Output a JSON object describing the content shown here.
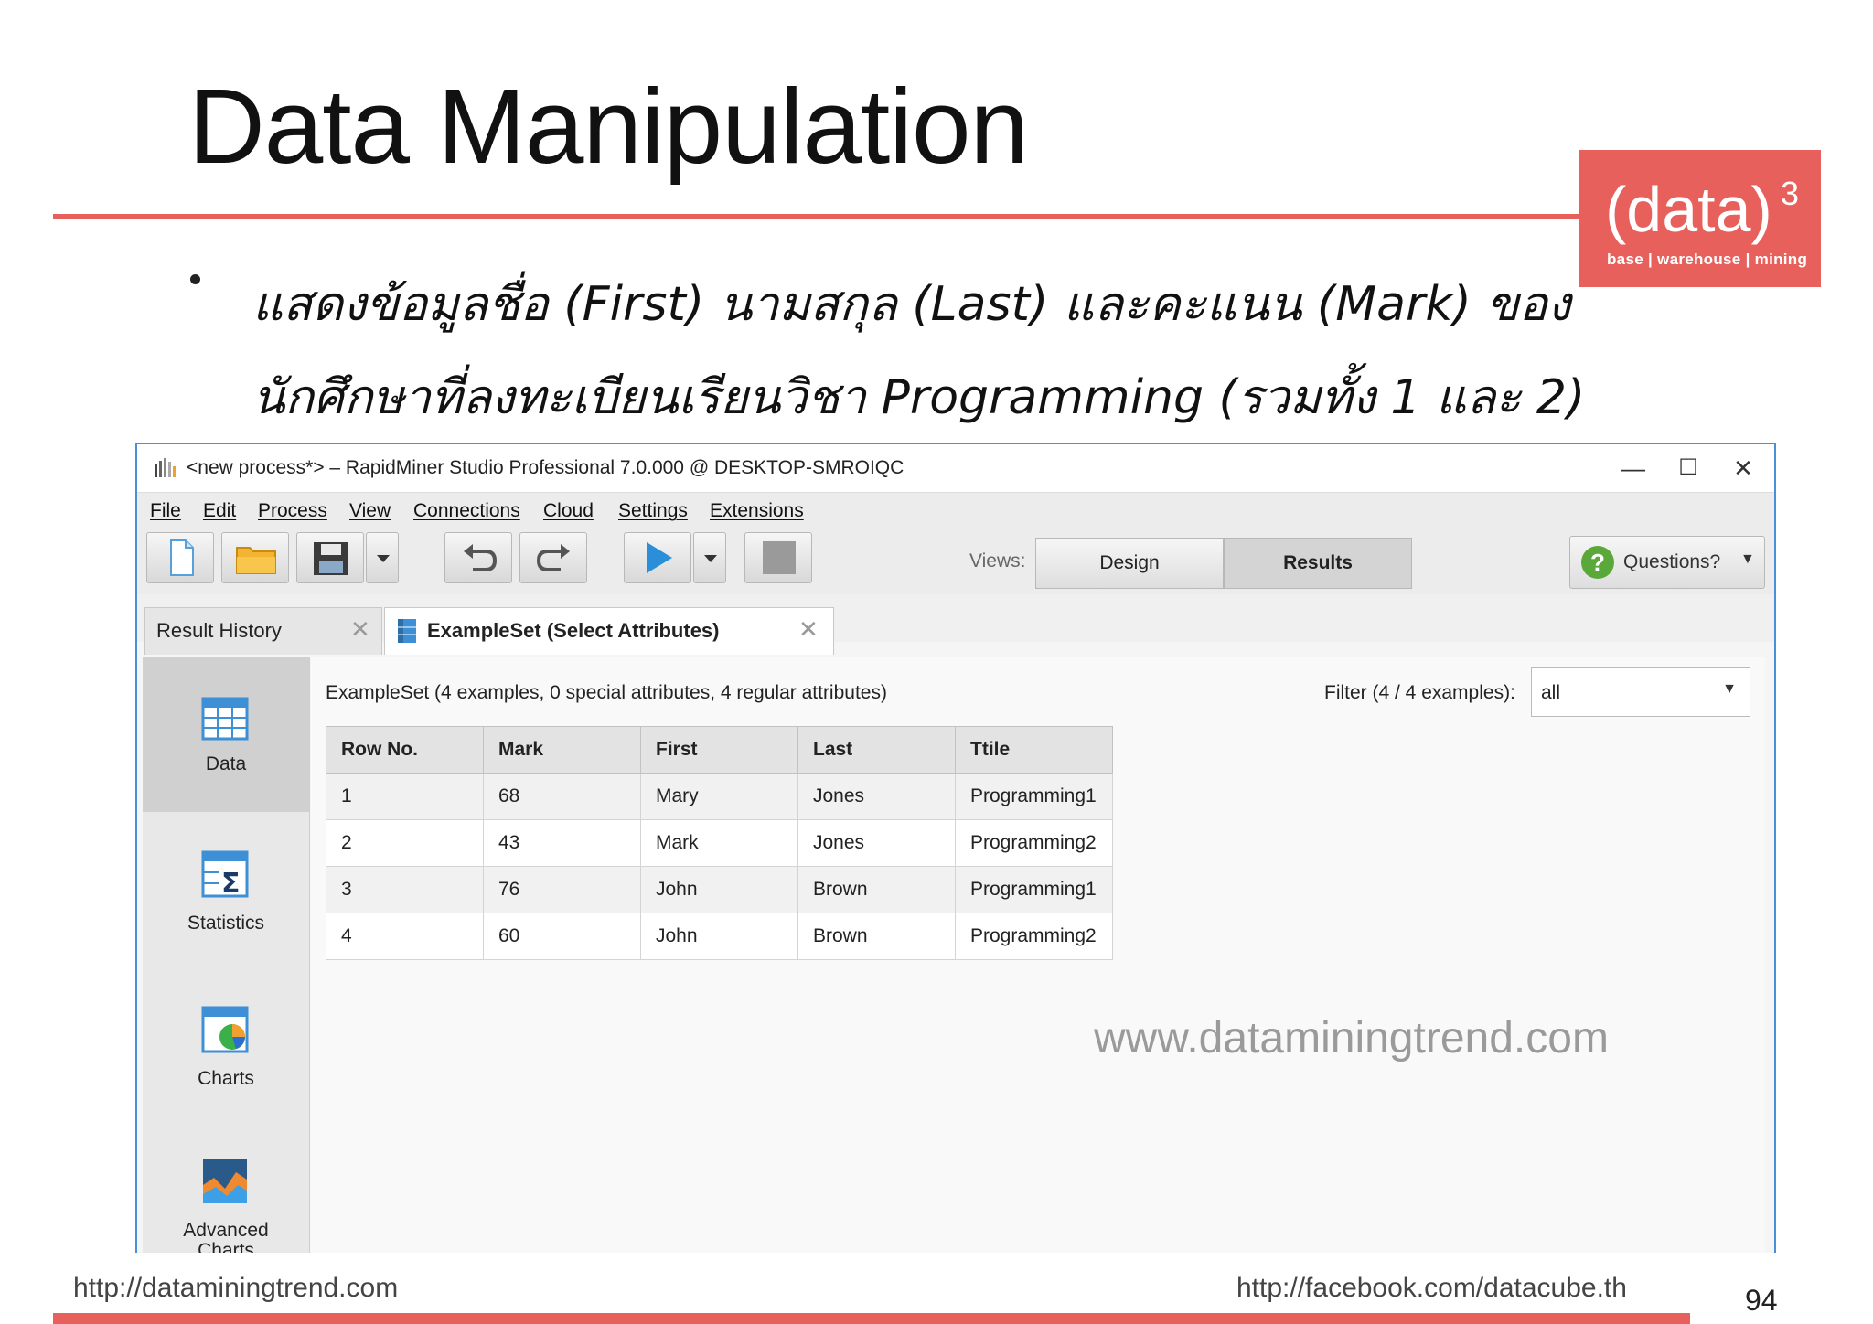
{
  "slide": {
    "title": "Data Manipulation",
    "bullet_line1": "แสดงข้อมูลชื่อ (First) นามสกุล (Last) และคะแนน (Mark) ของ",
    "bullet_line2": "นักศึกษาที่ลงทะเบียนเรียนวิชา Programming (รวมทั้ง 1 และ 2)",
    "brand": {
      "word": "(data)",
      "superscript": "3",
      "tagline": "base | warehouse | mining",
      "color": "#e8605c"
    },
    "watermark": "www.dataminingtrend.com",
    "footer_left": "http://dataminingtrend.com",
    "footer_right": "http://facebook.com/datacube.th",
    "page_number": "94"
  },
  "window": {
    "title": "<new process*> – RapidMiner Studio Professional 7.0.000 @ DESKTOP-SMROIQC",
    "controls": {
      "minimize": "—",
      "maximize": "☐",
      "close": "✕"
    },
    "menu": [
      "File",
      "Edit",
      "Process",
      "View",
      "Connections",
      "Cloud",
      "Settings",
      "Extensions"
    ],
    "toolbar": {
      "icons": [
        "new-process-icon",
        "open-folder-icon",
        "save-icon",
        "dropdown-icon",
        "undo-icon",
        "redo-icon",
        "run-icon",
        "dropdown-icon",
        "stop-icon"
      ],
      "views_label": "Views:",
      "views": [
        "Design",
        "Results"
      ],
      "active_view": "Results",
      "questions_label": "Questions?"
    },
    "tabs": [
      {
        "label": "Result History",
        "close": "✕"
      },
      {
        "label": "ExampleSet (Select Attributes)",
        "close": "✕"
      }
    ],
    "sidebar": [
      {
        "label": "Data",
        "icon": "data-table-icon",
        "active": true
      },
      {
        "label": "Statistics",
        "icon": "statistics-icon",
        "active": false
      },
      {
        "label": "Charts",
        "icon": "charts-icon",
        "active": false
      },
      {
        "label": "Advanced",
        "label2": "Charts",
        "icon": "advanced-charts-icon",
        "active": false
      }
    ],
    "results": {
      "summary": "ExampleSet (4 examples, 0 special attributes, 4 regular attributes)",
      "filter_label": "Filter (4 / 4 examples):",
      "filter_value": "all",
      "columns": [
        "Row No.",
        "Mark",
        "First",
        "Last",
        "Ttile"
      ],
      "rows": [
        [
          "1",
          "68",
          "Mary",
          "Jones",
          "Programming1"
        ],
        [
          "2",
          "43",
          "Mark",
          "Jones",
          "Programming2"
        ],
        [
          "3",
          "76",
          "John",
          "Brown",
          "Programming1"
        ],
        [
          "4",
          "60",
          "John",
          "Brown",
          "Programming2"
        ]
      ]
    }
  }
}
